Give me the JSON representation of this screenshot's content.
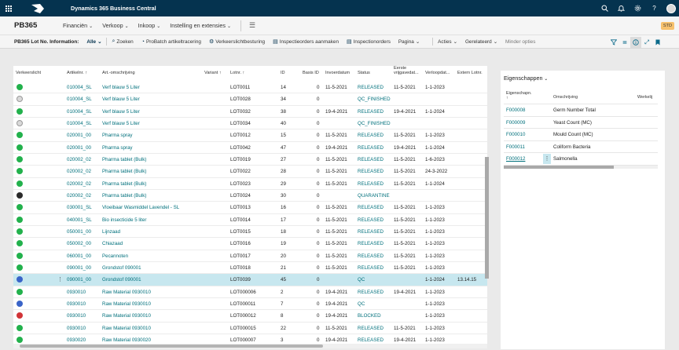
{
  "app": {
    "title": "Dynamics 365 Business Central",
    "company": "PB365",
    "badge": "STD"
  },
  "nav": [
    "Financiën",
    "Verkoop",
    "Inkoop",
    "Instelling en extensies"
  ],
  "actionbar": {
    "caption": "PB365 Lot No. Information:",
    "filter": "Alle",
    "actions": [
      {
        "icon": "search-icon",
        "label": "Zoeken"
      },
      {
        "icon": "probatch-icon",
        "label": "ProBatch artikeltracering"
      },
      {
        "icon": "traffic-light-icon",
        "label": "Verkeerslichtbesturing"
      },
      {
        "icon": "document-icon",
        "label": "Inspectieorders aanmaken"
      },
      {
        "icon": "document-icon",
        "label": "Inspectionorders"
      }
    ],
    "menus": [
      "Pagina",
      "Acties",
      "Gerelateerd"
    ],
    "fewer": "Minder opties"
  },
  "columns": {
    "traffic": "Verkeerslicht",
    "item": "Artikelnr. ↑",
    "desc": "Art.-omschrijving",
    "variant": "Variant ↑",
    "lot": "Lotnr. ↑",
    "id": "ID",
    "basis": "Basis ID",
    "inv": "Invoerdatum",
    "status": "Status",
    "first": "Eerste vrijgavedat...",
    "exp": "Verloopdat...",
    "ext": "Extern Lotnr."
  },
  "rows": [
    {
      "light": "green",
      "item": "010004_SL",
      "desc": "Verf blauw 5 Liter",
      "lot": "LOT0011",
      "id": "14",
      "basis": "0",
      "inv": "11-5-2021",
      "status": "RELEASED",
      "first": "11-5-2021",
      "exp": "1-1-2023",
      "ext": ""
    },
    {
      "light": "grey",
      "item": "010004_SL",
      "desc": "Verf blauw 5 Liter",
      "lot": "LOT0028",
      "id": "34",
      "basis": "0",
      "inv": "",
      "status": "QC_FINISHED",
      "first": "",
      "exp": "",
      "ext": ""
    },
    {
      "light": "green",
      "item": "010004_SL",
      "desc": "Verf blauw 5 Liter",
      "lot": "LOT0032",
      "id": "38",
      "basis": "0",
      "inv": "19-4-2021",
      "status": "RELEASED",
      "first": "19-4-2021",
      "exp": "1-1-2024",
      "ext": ""
    },
    {
      "light": "grey",
      "item": "010004_SL",
      "desc": "Verf blauw 5 Liter",
      "lot": "LOT0034",
      "id": "40",
      "basis": "0",
      "inv": "",
      "status": "QC_FINISHED",
      "first": "",
      "exp": "",
      "ext": ""
    },
    {
      "light": "green",
      "item": "020001_00",
      "desc": "Pharma spray",
      "lot": "LOT0012",
      "id": "15",
      "basis": "0",
      "inv": "11-5-2021",
      "status": "RELEASED",
      "first": "11-5-2021",
      "exp": "1-1-2023",
      "ext": ""
    },
    {
      "light": "green",
      "item": "020001_00",
      "desc": "Pharma spray",
      "lot": "LOT0042",
      "id": "47",
      "basis": "0",
      "inv": "19-4-2021",
      "status": "RELEASED",
      "first": "19-4-2021",
      "exp": "1-1-2024",
      "ext": ""
    },
    {
      "light": "green",
      "item": "020002_02",
      "desc": "Pharma tablet (Bulk)",
      "lot": "LOT0019",
      "id": "27",
      "basis": "0",
      "inv": "11-5-2021",
      "status": "RELEASED",
      "first": "11-5-2021",
      "exp": "1-6-2023",
      "ext": ""
    },
    {
      "light": "green",
      "item": "020002_02",
      "desc": "Pharma tablet (Bulk)",
      "lot": "LOT0022",
      "id": "28",
      "basis": "0",
      "inv": "11-5-2021",
      "status": "RELEASED",
      "first": "11-5-2021",
      "exp": "24-3-2022",
      "ext": ""
    },
    {
      "light": "green",
      "item": "020002_02",
      "desc": "Pharma tablet (Bulk)",
      "lot": "LOT0023",
      "id": "29",
      "basis": "0",
      "inv": "11-5-2021",
      "status": "RELEASED",
      "first": "11-5-2021",
      "exp": "1-1-2024",
      "ext": ""
    },
    {
      "light": "black",
      "item": "020002_02",
      "desc": "Pharma tablet (Bulk)",
      "lot": "LOT0024",
      "id": "30",
      "basis": "0",
      "inv": "",
      "status": "QUARANTINE",
      "first": "",
      "exp": "",
      "ext": ""
    },
    {
      "light": "green",
      "item": "030001_SL",
      "desc": "Vloeibaar Wasmiddel Lavendel - SL",
      "lot": "LOT0013",
      "id": "16",
      "basis": "0",
      "inv": "11-5-2021",
      "status": "RELEASED",
      "first": "11-5-2021",
      "exp": "1-1-2023",
      "ext": ""
    },
    {
      "light": "green",
      "item": "040001_SL",
      "desc": "Bio insecticide 5 liter",
      "lot": "LOT0014",
      "id": "17",
      "basis": "0",
      "inv": "11-5-2021",
      "status": "RELEASED",
      "first": "11-5-2021",
      "exp": "1-1-2023",
      "ext": ""
    },
    {
      "light": "green",
      "item": "050001_00",
      "desc": "Lijnzaad",
      "lot": "LOT0015",
      "id": "18",
      "basis": "0",
      "inv": "11-5-2021",
      "status": "RELEASED",
      "first": "11-5-2021",
      "exp": "1-1-2023",
      "ext": ""
    },
    {
      "light": "green",
      "item": "050002_00",
      "desc": "Chiazaad",
      "lot": "LOT0016",
      "id": "19",
      "basis": "0",
      "inv": "11-5-2021",
      "status": "RELEASED",
      "first": "11-5-2021",
      "exp": "1-1-2023",
      "ext": ""
    },
    {
      "light": "green",
      "item": "060001_00",
      "desc": "Pecannoten",
      "lot": "LOT0017",
      "id": "20",
      "basis": "0",
      "inv": "11-5-2021",
      "status": "RELEASED",
      "first": "11-5-2021",
      "exp": "1-1-2023",
      "ext": ""
    },
    {
      "light": "green",
      "item": "090001_00",
      "desc": "Grondstof 090001",
      "lot": "LOT0018",
      "id": "21",
      "basis": "0",
      "inv": "11-5-2021",
      "status": "RELEASED",
      "first": "11-5-2021",
      "exp": "1-1-2023",
      "ext": ""
    },
    {
      "light": "blue",
      "item": "090001_00",
      "desc": "Grondstof 090001",
      "lot": "LOT0039",
      "id": "45",
      "basis": "0",
      "inv": "",
      "status": "QC",
      "first": "",
      "exp": "1-1-2024",
      "ext": "13.14.15",
      "selected": true
    },
    {
      "light": "green",
      "item": "0930010",
      "desc": "Raw Material 0930010",
      "lot": "LOT000006",
      "id": "2",
      "basis": "0",
      "inv": "19-4-2021",
      "status": "RELEASED",
      "first": "19-4-2021",
      "exp": "1-1-2023",
      "ext": ""
    },
    {
      "light": "blue",
      "item": "0930010",
      "desc": "Raw Material 0930010",
      "lot": "LOT000011",
      "id": "7",
      "basis": "0",
      "inv": "19-4-2021",
      "status": "QC",
      "first": "",
      "exp": "1-1-2023",
      "ext": ""
    },
    {
      "light": "red",
      "item": "0930010",
      "desc": "Raw Material 0930010",
      "lot": "LOT000012",
      "id": "8",
      "basis": "0",
      "inv": "19-4-2021",
      "status": "BLOCKED",
      "first": "",
      "exp": "1-1-2023",
      "ext": ""
    },
    {
      "light": "green",
      "item": "0930010",
      "desc": "Raw Material 0930010",
      "lot": "LOT000015",
      "id": "22",
      "basis": "0",
      "inv": "11-5-2021",
      "status": "RELEASED",
      "first": "11-5-2021",
      "exp": "1-1-2023",
      "ext": ""
    },
    {
      "light": "green",
      "item": "0930020",
      "desc": "Raw Material 0930020",
      "lot": "LOT000007",
      "id": "3",
      "basis": "0",
      "inv": "19-4-2021",
      "status": "RELEASED",
      "first": "19-4-2021",
      "exp": "1-1-2023",
      "ext": ""
    }
  ],
  "lightColors": {
    "green": "#22b14c",
    "grey": "#d9d9d9",
    "black": "#2b2b2b",
    "blue": "#3a64c8",
    "red": "#d13438"
  },
  "factbox": {
    "title": "Eigenschappen",
    "headers": {
      "code": "Eigenschapn. ↑",
      "desc": "Omschrijving",
      "value": "Werkelij"
    },
    "rows": [
      {
        "code": "F000008",
        "desc": "Germ Number Total"
      },
      {
        "code": "F000009",
        "desc": "Yeast Count (MC)"
      },
      {
        "code": "F000010",
        "desc": "Mould Count (MC)"
      },
      {
        "code": "F000011",
        "desc": "Coliform Bacteria"
      },
      {
        "code": "F000012",
        "desc": "Salmonella",
        "selected": true
      }
    ]
  }
}
